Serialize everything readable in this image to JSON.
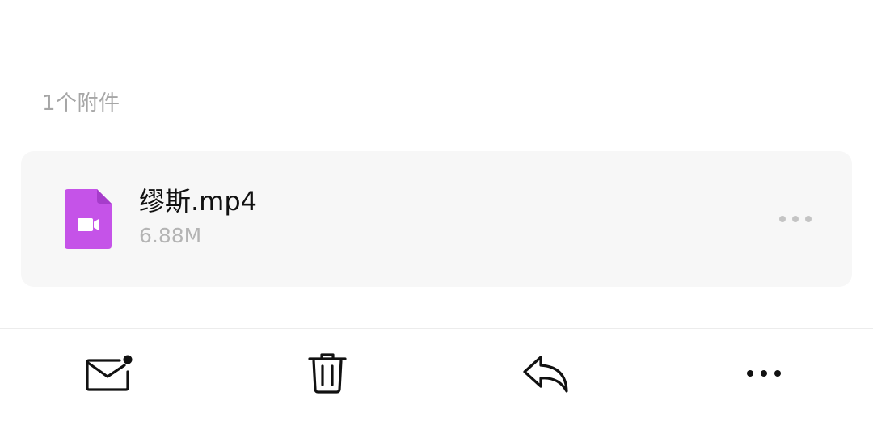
{
  "attachments": {
    "count_label": "1个附件",
    "items": [
      {
        "name": "缪斯.mp4",
        "size": "6.88M",
        "icon": "video-file-icon",
        "icon_color": "#c553e8"
      }
    ]
  },
  "toolbar": {
    "buttons": [
      {
        "icon": "mark-unread-mail-icon"
      },
      {
        "icon": "trash-icon"
      },
      {
        "icon": "reply-icon"
      },
      {
        "icon": "more-icon"
      }
    ]
  },
  "colors": {
    "card_background": "#f7f7f7",
    "muted_text": "#a6a6a6",
    "primary_text": "#111111"
  }
}
